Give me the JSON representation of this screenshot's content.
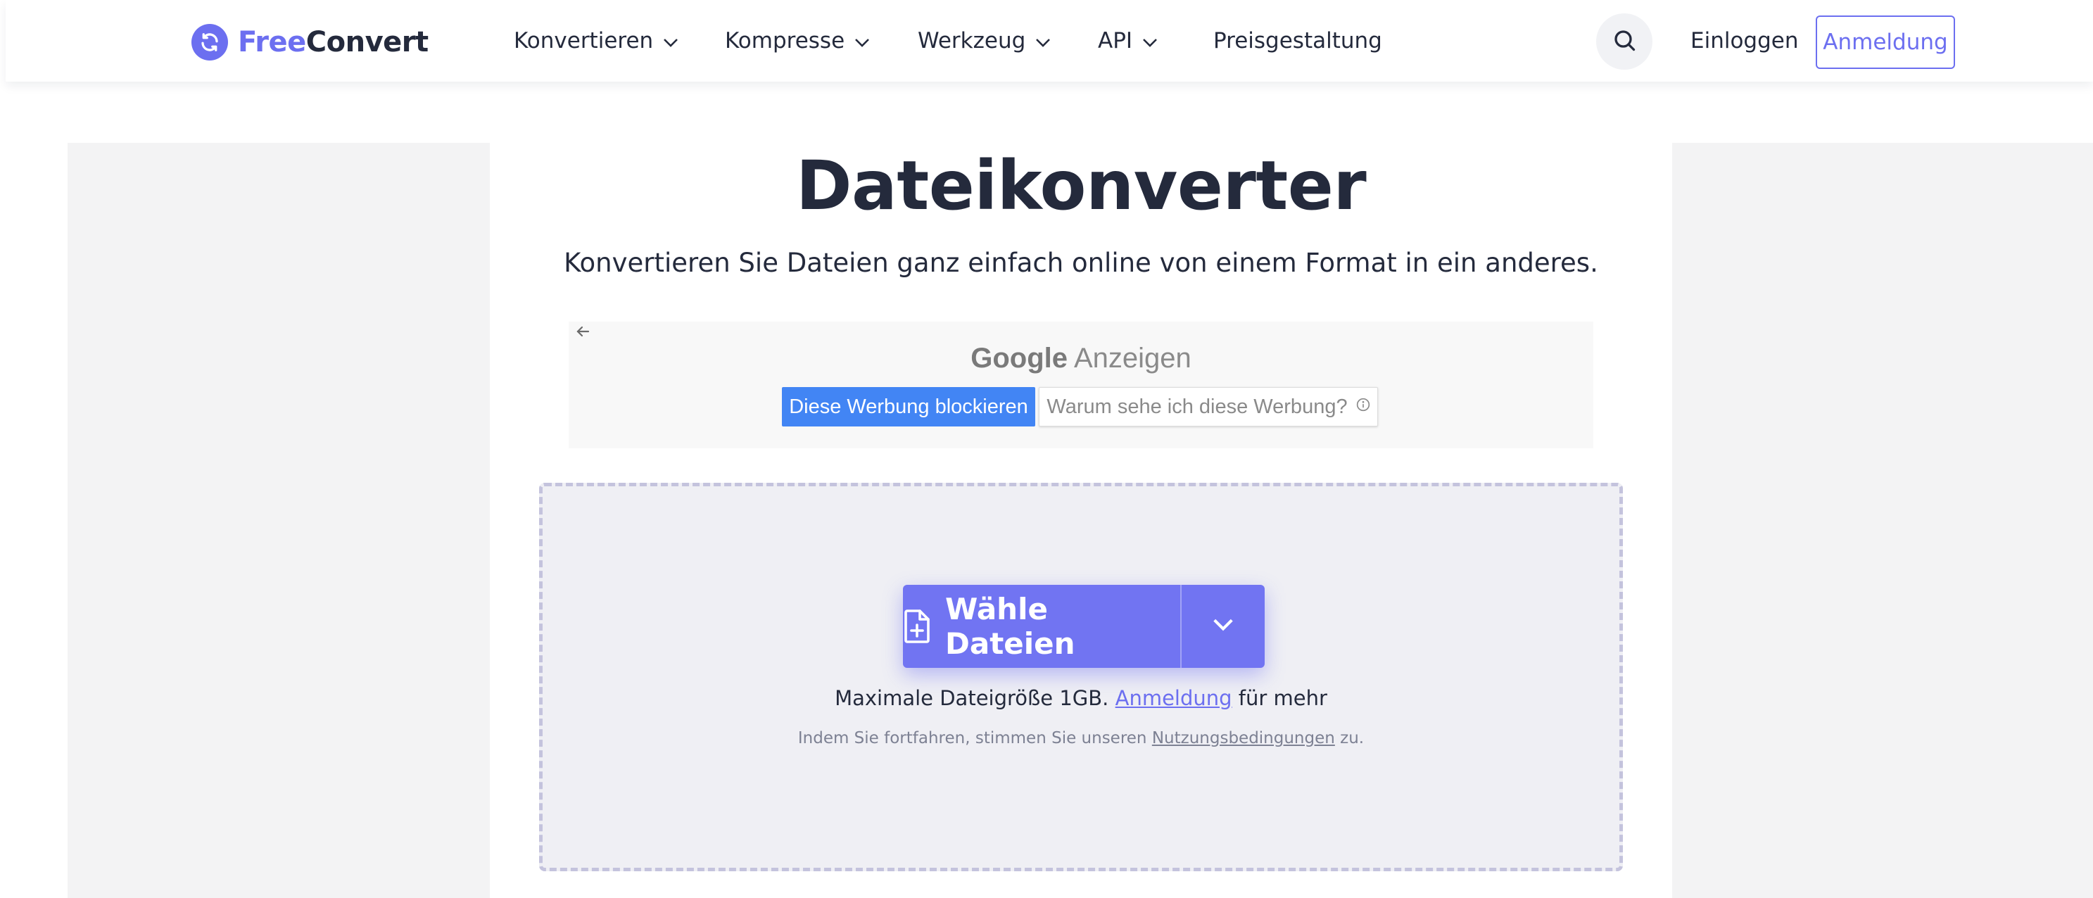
{
  "header": {
    "logo": {
      "free": "Free",
      "convert": "Convert"
    },
    "nav": [
      {
        "label": "Konvertieren",
        "dropdown": true
      },
      {
        "label": "Kompresse",
        "dropdown": true
      },
      {
        "label": "Werkzeug",
        "dropdown": true
      },
      {
        "label": "API",
        "dropdown": true
      },
      {
        "label": "Preisgestaltung",
        "dropdown": false
      }
    ],
    "login": "Einloggen",
    "signup": "Anmeldung"
  },
  "main": {
    "title": "Dateikonverter",
    "subtitle": "Konvertieren Sie Dateien ganz einfach online von einem Format in ein anderes."
  },
  "ad": {
    "google": "Google",
    "anzeigen": "Anzeigen",
    "block_label": "Diese Werbung blockieren",
    "why_label": "Warum sehe ich diese Werbung?"
  },
  "upload": {
    "choose_label": "Wähle Dateien",
    "limit_prefix": "Maximale Dateigröße 1GB.",
    "limit_link": "Anmeldung",
    "limit_suffix": "für mehr",
    "terms_prefix": "Indem Sie fortfahren, stimmen Sie unseren",
    "terms_link": "Nutzungsbedingungen",
    "terms_suffix": "zu."
  },
  "colors": {
    "brand": "#6c6ff0",
    "button": "#7174f2",
    "ad_button": "#4285f4",
    "text": "#242a3c"
  },
  "icons": [
    "logo-sync-icon",
    "chevron-down-icon",
    "search-icon",
    "back-arrow-icon",
    "info-icon",
    "file-plus-icon"
  ]
}
